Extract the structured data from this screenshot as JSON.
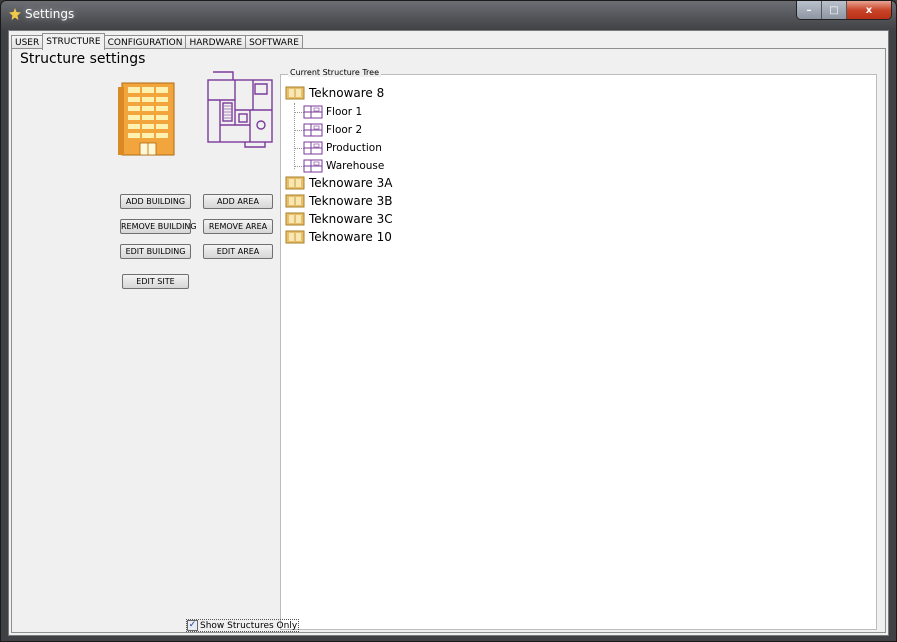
{
  "window": {
    "title": "Settings",
    "caption": {
      "minimize": "–",
      "maximize": "□",
      "close": "x"
    }
  },
  "tabs": [
    {
      "label": "USER",
      "active": false
    },
    {
      "label": "STRUCTURE",
      "active": true
    },
    {
      "label": "CONFIGURATION",
      "active": false
    },
    {
      "label": "HARDWARE",
      "active": false
    },
    {
      "label": "SOFTWARE",
      "active": false
    }
  ],
  "panel": {
    "title": "Structure settings",
    "buttons": {
      "add_building": "ADD BUILDING",
      "remove_building": "REMOVE BUILDING",
      "edit_building": "EDIT BUILDING",
      "edit_site": "EDIT SITE",
      "add_area": "ADD AREA",
      "remove_area": "REMOVE AREA",
      "edit_area": "EDIT AREA"
    },
    "show_structures_only": {
      "label": "Show Structures Only",
      "checked": true
    }
  },
  "tree": {
    "legend": "Current Structure Tree",
    "roots": [
      {
        "label": "Tekno‌ware 8",
        "children": [
          "Floor 1",
          "Floor 2",
          "Production",
          "Warehouse"
        ]
      },
      {
        "label": "Teknoware 3A",
        "children": []
      },
      {
        "label": "Teknoware 3B",
        "children": []
      },
      {
        "label": "Teknoware 3C",
        "children": []
      },
      {
        "label": "Teknoware 10",
        "children": []
      }
    ]
  },
  "colors": {
    "building_orange": "#f2a53c",
    "building_window": "#fff2b0",
    "floorplan_purple": "#7a3a9a",
    "folder_yellow": "#e8c06a"
  },
  "icons": {
    "title": "settings-app-icon",
    "building": "building-icon",
    "area": "floorplan-icon",
    "root_node": "folder-icon",
    "child_node": "floorplan-small-icon"
  }
}
